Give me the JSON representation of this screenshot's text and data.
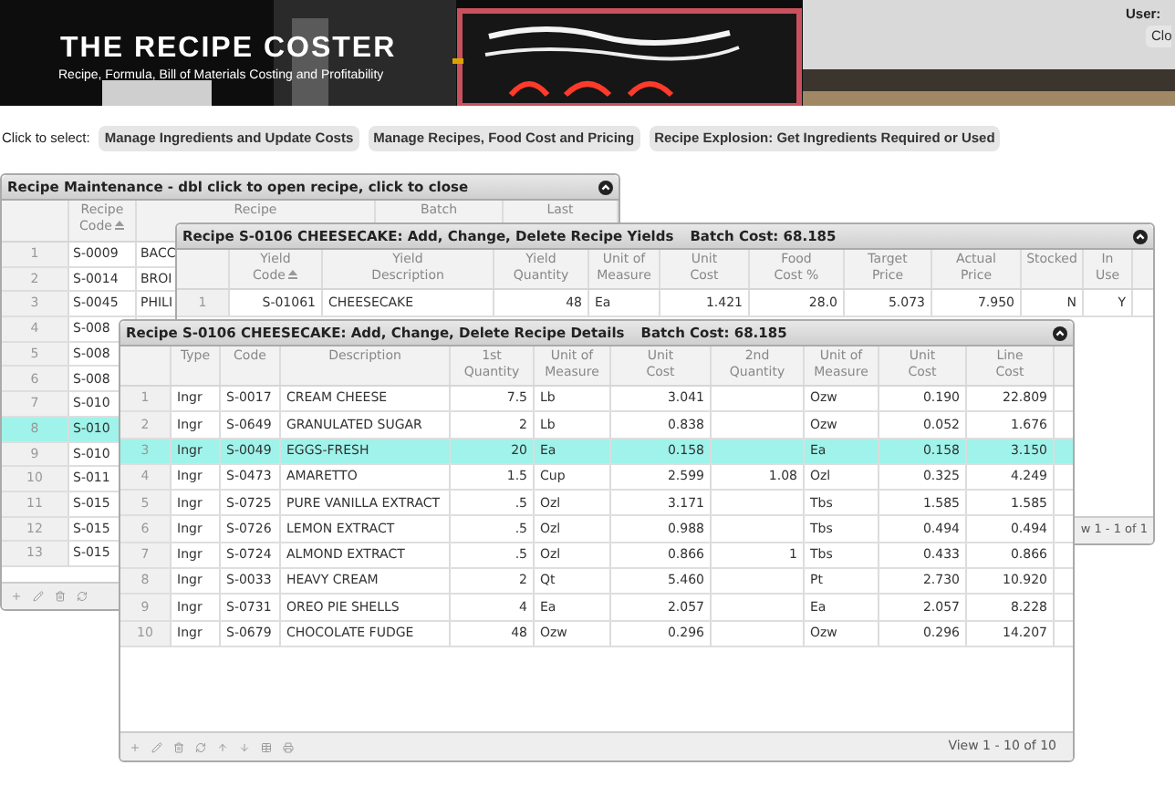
{
  "header": {
    "title": "THE RECIPE COSTER",
    "subtitle": "Recipe, Formula, Bill of Materials Costing and Profitability",
    "user_label": "User:",
    "close_button": "Clo"
  },
  "nav": {
    "label": "Click to select:",
    "buttons": [
      "Manage Ingredients and Update Costs",
      "Manage Recipes, Food Cost and Pricing",
      "Recipe Explosion: Get Ingredients Required or Used"
    ]
  },
  "maintenance": {
    "title": "Recipe Maintenance - dbl click to open recipe, click to close",
    "columns": [
      {
        "label": "Recipe\nCode",
        "sorted": true
      },
      {
        "label": "Recipe",
        "sorted": false
      },
      {
        "label": "Batch",
        "sorted": false
      },
      {
        "label": "Last",
        "sorted": false
      }
    ],
    "rows": [
      {
        "number": "1",
        "code": "S-0009",
        "description": "BACC",
        "selected": false
      },
      {
        "number": "2",
        "code": "S-0014",
        "description": "BROI",
        "selected": false
      },
      {
        "number": "3",
        "code": "S-0045",
        "description": "PHILI",
        "selected": false
      },
      {
        "number": "4",
        "code": "S-008",
        "selected": false
      },
      {
        "number": "5",
        "code": "S-008",
        "selected": false
      },
      {
        "number": "6",
        "code": "S-008",
        "selected": false
      },
      {
        "number": "7",
        "code": "S-010",
        "selected": false
      },
      {
        "number": "8",
        "code": "S-010",
        "selected": true
      },
      {
        "number": "9",
        "code": "S-010",
        "selected": false
      },
      {
        "number": "10",
        "code": "S-011",
        "selected": false
      },
      {
        "number": "11",
        "code": "S-015",
        "selected": false
      },
      {
        "number": "12",
        "code": "S-015",
        "selected": false
      },
      {
        "number": "13",
        "code": "S-015",
        "selected": false
      }
    ]
  },
  "yields": {
    "title": "Recipe S-0106 CHEESECAKE: Add, Change, Delete Recipe Yields",
    "batch_cost": "Batch Cost: 68.185",
    "columns": [
      {
        "label": "Yield\nCode",
        "sorted": true
      },
      {
        "label": "Yield\nDescription",
        "sorted": false
      },
      {
        "label": "Yield\nQuantity",
        "sorted": false
      },
      {
        "label": "Unit of\nMeasure",
        "sorted": false
      },
      {
        "label": "Unit\nCost",
        "sorted": false
      },
      {
        "label": "Food\nCost %",
        "sorted": false
      },
      {
        "label": "Target\nPrice",
        "sorted": false
      },
      {
        "label": "Actual\nPrice",
        "sorted": false
      },
      {
        "label": "Stocked",
        "sorted": false
      },
      {
        "label": "In\nUse",
        "sorted": false
      }
    ],
    "rows": [
      {
        "number": "1",
        "yield_code": "S-01061",
        "yield_description": "CHEESECAKE",
        "yield_quantity": "48",
        "unit": "Ea",
        "unit_cost": "1.421",
        "food_cost": "28.0",
        "target_price": "5.073",
        "actual_price": "7.950",
        "stocked": "N",
        "in_use": "Y",
        "selected": false
      }
    ],
    "pager": "w 1 - 1 of 1"
  },
  "details": {
    "title": "Recipe S-0106 CHEESECAKE: Add, Change, Delete Recipe Details",
    "batch_cost": "Batch Cost: 68.185",
    "columns": [
      {
        "label": "Type",
        "sorted": false
      },
      {
        "label": "Code",
        "sorted": false
      },
      {
        "label": "Description",
        "sorted": false
      },
      {
        "label": "1st\nQuantity",
        "sorted": false
      },
      {
        "label": "Unit of\nMeasure",
        "sorted": false
      },
      {
        "label": "Unit\nCost",
        "sorted": false
      },
      {
        "label": "2nd\nQuantity",
        "sorted": false
      },
      {
        "label": "Unit of\nMeasure",
        "sorted": false
      },
      {
        "label": "Unit\nCost",
        "sorted": false
      },
      {
        "label": "Line\nCost",
        "sorted": false
      }
    ],
    "rows": [
      {
        "number": "1",
        "type": "Ingr",
        "code": "S-0017",
        "description": "CREAM CHEESE",
        "quantity_1": "7.5",
        "unit_1": "Lb",
        "unit_cost_1": "3.041",
        "unit_2": "Ozw",
        "unit_cost_2": "0.190",
        "line_cost": "22.809",
        "selected": false
      },
      {
        "number": "2",
        "type": "Ingr",
        "code": "S-0649",
        "description": "GRANULATED SUGAR",
        "quantity_1": "2",
        "unit_1": "Lb",
        "unit_cost_1": "0.838",
        "unit_2": "Ozw",
        "unit_cost_2": "0.052",
        "line_cost": "1.676",
        "selected": false
      },
      {
        "number": "3",
        "type": "Ingr",
        "code": "S-0049",
        "description": "EGGS-FRESH",
        "quantity_1": "20",
        "unit_1": "Ea",
        "unit_cost_1": "0.158",
        "unit_2": "Ea",
        "unit_cost_2": "0.158",
        "line_cost": "3.150",
        "selected": true
      },
      {
        "number": "4",
        "type": "Ingr",
        "code": "S-0473",
        "description": "AMARETTO",
        "quantity_1": "1.5",
        "unit_1": "Cup",
        "unit_cost_1": "2.599",
        "quantity_2": "1.08",
        "unit_2": "Ozl",
        "unit_cost_2": "0.325",
        "line_cost": "4.249",
        "selected": false
      },
      {
        "number": "5",
        "type": "Ingr",
        "code": "S-0725",
        "description": "PURE VANILLA EXTRACT",
        "quantity_1": ".5",
        "unit_1": "Ozl",
        "unit_cost_1": "3.171",
        "unit_2": "Tbs",
        "unit_cost_2": "1.585",
        "line_cost": "1.585",
        "selected": false
      },
      {
        "number": "6",
        "type": "Ingr",
        "code": "S-0726",
        "description": "LEMON EXTRACT",
        "quantity_1": ".5",
        "unit_1": "Ozl",
        "unit_cost_1": "0.988",
        "unit_2": "Tbs",
        "unit_cost_2": "0.494",
        "line_cost": "0.494",
        "selected": false
      },
      {
        "number": "7",
        "type": "Ingr",
        "code": "S-0724",
        "description": "ALMOND EXTRACT",
        "quantity_1": ".5",
        "unit_1": "Ozl",
        "unit_cost_1": "0.866",
        "quantity_2": "1",
        "unit_2": "Tbs",
        "unit_cost_2": "0.433",
        "line_cost": "0.866",
        "selected": false
      },
      {
        "number": "8",
        "type": "Ingr",
        "code": "S-0033",
        "description": "HEAVY CREAM",
        "quantity_1": "2",
        "unit_1": "Qt",
        "unit_cost_1": "5.460",
        "unit_2": "Pt",
        "unit_cost_2": "2.730",
        "line_cost": "10.920",
        "selected": false
      },
      {
        "number": "9",
        "type": "Ingr",
        "code": "S-0731",
        "description": "OREO PIE SHELLS",
        "quantity_1": "4",
        "unit_1": "Ea",
        "unit_cost_1": "2.057",
        "unit_2": "Ea",
        "unit_cost_2": "2.057",
        "line_cost": "8.228",
        "selected": false
      },
      {
        "number": "10",
        "type": "Ingr",
        "code": "S-0679",
        "description": "CHOCOLATE FUDGE",
        "quantity_1": "48",
        "unit_1": "Ozw",
        "unit_cost_1": "0.296",
        "unit_2": "Ozw",
        "unit_cost_2": "0.296",
        "line_cost": "14.207",
        "selected": false
      }
    ],
    "pager": "View 1 - 10 of 10"
  }
}
